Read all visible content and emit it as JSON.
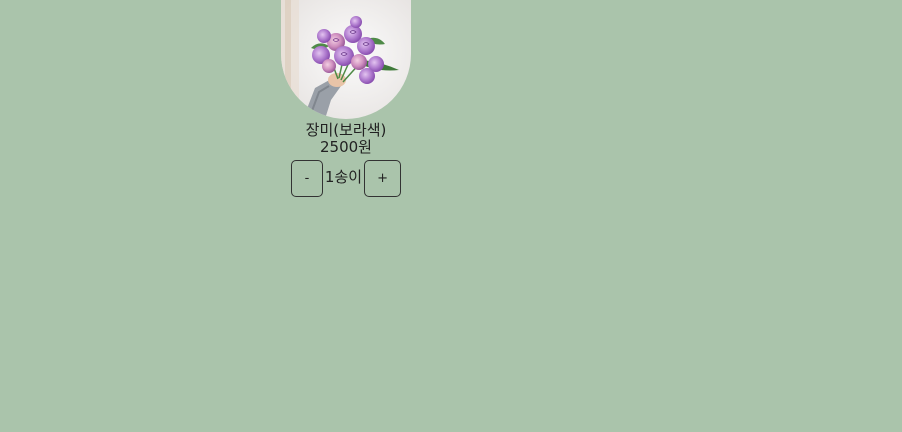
{
  "product": {
    "image_alt_icon": "purple-rose-bouquet-photo",
    "name": "장미(보라색)",
    "price": "2500원",
    "quantity": "1송이",
    "decrease_label": "-",
    "increase_label": "+"
  },
  "colors": {
    "background": "#aac4ab",
    "button_border": "#333333",
    "rose": "#b07ccf",
    "rose_dark": "#8a4fb0",
    "leaf": "#3f7a3a"
  }
}
